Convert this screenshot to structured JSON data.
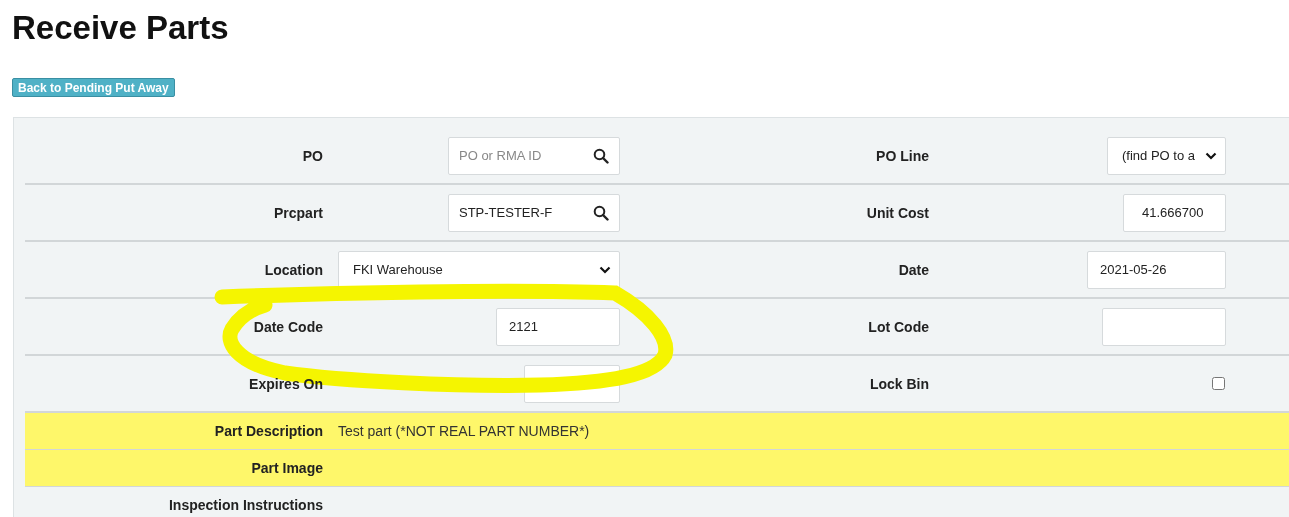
{
  "title": "Receive Parts",
  "back_button": "Back to Pending Put Away",
  "rows": [
    {
      "left": {
        "label": "PO",
        "field": {
          "kind": "search",
          "placeholder": "PO or RMA ID"
        }
      },
      "right": {
        "label": "PO Line",
        "field": {
          "kind": "select",
          "value": "(find PO to a"
        }
      }
    },
    {
      "left": {
        "label": "Prcpart",
        "field": {
          "kind": "search",
          "value": "STP-TESTER-F"
        }
      },
      "right": {
        "label": "Unit Cost",
        "field": {
          "kind": "text",
          "value": "41.666700"
        }
      }
    },
    {
      "left": {
        "label": "Location",
        "field": {
          "kind": "select",
          "value": "FKI Warehouse"
        }
      },
      "right": {
        "label": "Date",
        "field": {
          "kind": "text",
          "value": "2021-05-26"
        }
      }
    },
    {
      "left": {
        "label": "Date Code",
        "field": {
          "kind": "text",
          "value": "2121"
        }
      },
      "right": {
        "label": "Lot Code",
        "field": {
          "kind": "text"
        }
      }
    },
    {
      "left": {
        "label": "Expires On",
        "field": {
          "kind": "text"
        }
      },
      "right": {
        "label": "Lock Bin",
        "field": {
          "kind": "checkbox",
          "checked": false
        }
      }
    }
  ],
  "info_rows": [
    {
      "label": "Part Description",
      "value": "Test part (*NOT REAL PART NUMBER*)",
      "highlighted": true
    },
    {
      "label": "Part Image",
      "highlighted": true
    },
    {
      "label": "Inspection Instructions",
      "highlighted": false
    }
  ],
  "annotation": {
    "kind": "ellipse"
  }
}
